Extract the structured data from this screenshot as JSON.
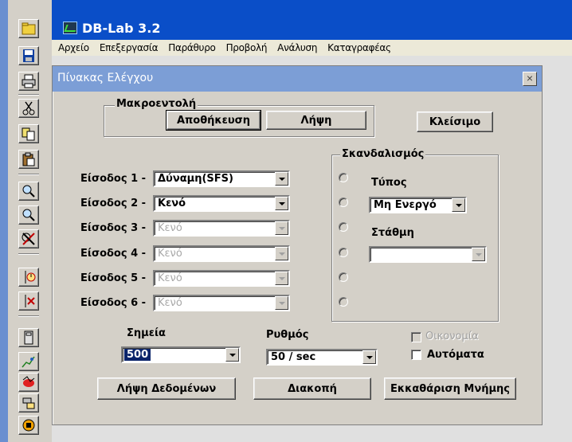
{
  "app": {
    "title": "DB-Lab 3.2",
    "menu": [
      "Αρχείο",
      "Επεξεργασία",
      "Παράθυρο",
      "Προβολή",
      "Ανάλυση",
      "Καταγραφέας"
    ]
  },
  "toolbar": {
    "buttons": [
      "folder-icon",
      "save-icon",
      "print-icon",
      "cut-icon",
      "copy-icon",
      "paste-icon",
      "zoom-in-icon",
      "zoom-out-icon",
      "zoom-reset-icon",
      "cursor-time-icon",
      "cursor-delete-icon",
      "calculator-icon",
      "graph-icon",
      "record-icon",
      "ruler-icon",
      "stop-icon"
    ]
  },
  "dialog": {
    "title": "Πίνακας Ελέγχου",
    "close": "×",
    "macro": {
      "label": "Μακροεντολή",
      "save": "Αποθήκευση",
      "load": "Λήψη"
    },
    "close_button": "Κλείσιμο",
    "inputs": [
      {
        "label": "Είσοδος 1 -",
        "value": "Δύναμη(SFS)",
        "enabled": true
      },
      {
        "label": "Είσοδος 2 -",
        "value": "Κενό",
        "enabled": true
      },
      {
        "label": "Είσοδος 3 -",
        "value": "Κενό",
        "enabled": false
      },
      {
        "label": "Είσοδος 4 -",
        "value": "Κενό",
        "enabled": false
      },
      {
        "label": "Είσοδος 5 -",
        "value": "Κενό",
        "enabled": false
      },
      {
        "label": "Είσοδος 6 -",
        "value": "Κενό",
        "enabled": false
      }
    ],
    "trigger": {
      "label": "Σκανδαλισμός",
      "type_label": "Τύπος",
      "type_value": "Μη Ενεργό",
      "level_label": "Στάθμη",
      "level_value": ""
    },
    "points": {
      "label": "Σημεία",
      "value": "500"
    },
    "rate": {
      "label": "Ρυθμός",
      "value": "50 / sec"
    },
    "economy": {
      "label": "Οικονομία",
      "checked": false,
      "enabled": false
    },
    "auto": {
      "label": "Αυτόματα",
      "checked": false,
      "enabled": true
    },
    "buttons": {
      "acquire": "Λήψη Δεδομένων",
      "stop": "Διακοπή",
      "clear": "Εκκαθάριση Μνήμης"
    }
  },
  "colors": {
    "app_titlebar": "#0a4ec8",
    "dialog_titlebar": "#7c9ed6",
    "selection": "#0a246a"
  }
}
